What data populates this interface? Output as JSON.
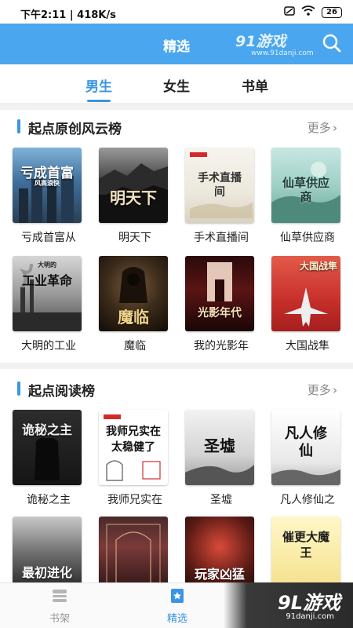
{
  "status_bar": {
    "time": "下午2:11",
    "speed": "418K/s",
    "battery": "26"
  },
  "header": {
    "title": "精选",
    "watermark_logo": "91游戏",
    "watermark_url": "www.91danji.com"
  },
  "tabs": [
    {
      "label": "男生",
      "active": true
    },
    {
      "label": "女生",
      "active": false
    },
    {
      "label": "书单",
      "active": false
    }
  ],
  "sections": [
    {
      "title": "起点原创风云榜",
      "more_label": "更多",
      "books": [
        {
          "name": "亏成首富从",
          "cover_text": "亏成首富",
          "cover_sub": "风高浪快"
        },
        {
          "name": "明天下",
          "cover_text": "明天下",
          "cover_sub": ""
        },
        {
          "name": "手术直播间",
          "cover_text": "手术直播间",
          "cover_sub": ""
        },
        {
          "name": "仙草供应商",
          "cover_text": "仙草供应商",
          "cover_sub": ""
        },
        {
          "name": "大明的工业",
          "cover_text": "工业革命",
          "cover_sub": "大明的"
        },
        {
          "name": "魔临",
          "cover_text": "魔临",
          "cover_sub": ""
        },
        {
          "name": "我的光影年",
          "cover_text": "光影年代",
          "cover_sub": ""
        },
        {
          "name": "大国战隼",
          "cover_text": "大国战隼",
          "cover_sub": ""
        }
      ]
    },
    {
      "title": "起点阅读榜",
      "more_label": "更多",
      "books": [
        {
          "name": "诡秘之主",
          "cover_text": "诡秘之主",
          "cover_sub": ""
        },
        {
          "name": "我师兄实在",
          "cover_text": "我师兄实在 太稳健了",
          "cover_sub": ""
        },
        {
          "name": "圣墟",
          "cover_text": "圣墟",
          "cover_sub": ""
        },
        {
          "name": "凡人修仙之",
          "cover_text": "凡人修仙",
          "cover_sub": ""
        },
        {
          "name": "",
          "cover_text": "最初进化",
          "cover_sub": ""
        },
        {
          "name": "",
          "cover_text": "",
          "cover_sub": ""
        },
        {
          "name": "",
          "cover_text": "玩家凶猛",
          "cover_sub": ""
        },
        {
          "name": "",
          "cover_text": "催更大魔王",
          "cover_sub": ""
        }
      ]
    }
  ],
  "bottom_nav": [
    {
      "label": "书架",
      "icon": "bookshelf-icon",
      "active": false
    },
    {
      "label": "精选",
      "icon": "star-book-icon",
      "active": true
    }
  ],
  "bottom_watermark": {
    "logo": "9L游戏",
    "url": "91danji.com"
  },
  "colors": {
    "accent": "#3a95e4",
    "header_bg": "#4aa6ee"
  }
}
